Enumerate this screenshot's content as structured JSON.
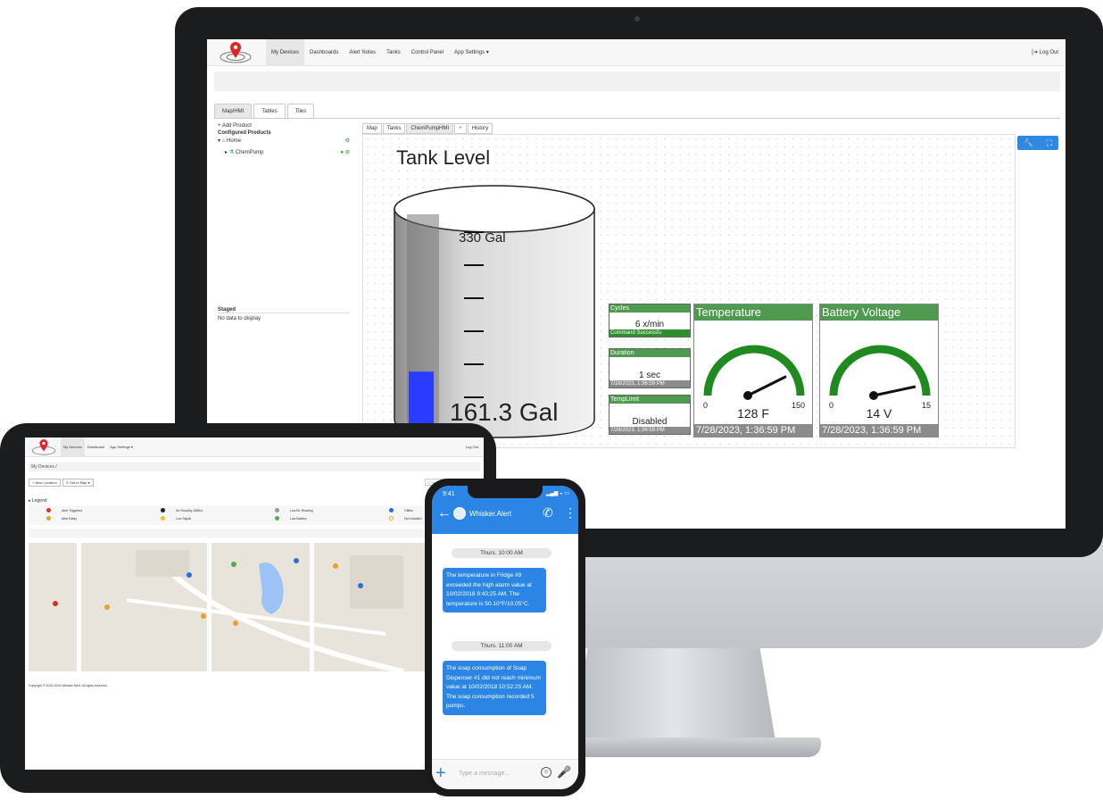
{
  "app": {
    "nav": {
      "items": [
        "My Devices",
        "Dashboards",
        "Alert Notes",
        "Tanks",
        "Control Panel",
        "App Settings ▾"
      ],
      "logout": "[➜ Log Out"
    },
    "main_tabs": [
      "Map/HMI",
      "Tables",
      "Tiles"
    ],
    "left_panel": {
      "add_product": "+ Add Product",
      "configured_title": "Configured Products",
      "tree": [
        "Home",
        "ChemPump"
      ],
      "staged_title": "Staged",
      "staged_empty": "No data to display"
    },
    "hmi_tabs": [
      "Map",
      "Tanks",
      "ChemPumpHMI",
      "History"
    ],
    "tank": {
      "title": "Tank Level",
      "capacity_label": "330 Gal",
      "level_label": "161.3 Gal",
      "fill_fraction": 0.29
    },
    "mini_panels": [
      {
        "title": "Cycles",
        "value": "6 x/min",
        "footer": "Command Successfu"
      },
      {
        "title": "Duration",
        "value": "1 sec",
        "footer": "7/28/2023, 1:36:59 PM"
      },
      {
        "title": "TempLimit",
        "value": "Disabled",
        "footer": "7/28/2023, 1:36:59 PM"
      }
    ],
    "gauges": [
      {
        "title": "Temperature",
        "min": "0",
        "max": "150",
        "value": "128 F",
        "fraction": 0.853,
        "timestamp": "7/28/2023, 1:36:59 PM"
      },
      {
        "title": "Battery Voltage",
        "min": "0",
        "max": "15",
        "value": "14 V",
        "fraction": 0.933,
        "timestamp": "7/28/2023, 1:36:59 PM"
      }
    ],
    "colors": {
      "accent": "#2d8ae0",
      "panel_green": "#4e9a4e",
      "gauge_green": "#1f8a1f"
    }
  },
  "tablet": {
    "nav": {
      "items": [
        "My Devices",
        "Dashboard",
        "App Settings ▾"
      ],
      "right": "Log Out"
    },
    "breadcrumb": "My Devices /",
    "buttons": [
      "+ New Location",
      "⊙ Set to Map ▾"
    ],
    "search_placeholder": "Q Search...",
    "legend_title": "▸ Legend",
    "legend": [
      "Alert Triggered",
      "Alert Delay",
      "No Reading 168hrs",
      "Low Signal",
      "Low Bt. Reading",
      "Low Battery",
      "Offline",
      "Not Installed"
    ],
    "footer": "Copyright © 2015-2019 Whisker Alert. All rights reserved."
  },
  "phone": {
    "time": "9:41",
    "contact": "Whisker.Alert",
    "messages": [
      {
        "time": "Thurs. 10:00 AM",
        "text": "The temperature in Fridge #9 exceeded the high alarm value at 10/02/2018 9:43:25 AM. The temperature is 50.10°F/10.05°C."
      },
      {
        "time": "Thurs. 11:00 AM",
        "text": "The soap consumption of Soap Dispenser #1 did not reach minimum value at 10/02/2018 10:52:25 AM. The soap consumption recorded 5 pumps."
      }
    ],
    "input_placeholder": "Type a message..."
  }
}
